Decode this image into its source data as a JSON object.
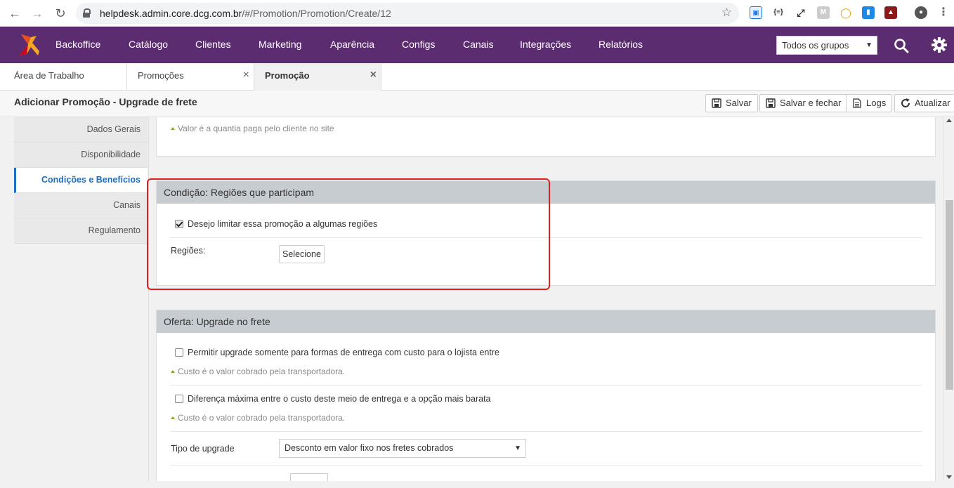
{
  "browser": {
    "url_host": "helpdesk.admin.core.dcg.com.br",
    "url_path": "/#/Promotion/Promotion/Create/12"
  },
  "header": {
    "menu": [
      "Backoffice",
      "Catálogo",
      "Clientes",
      "Marketing",
      "Aparência",
      "Configs",
      "Canais",
      "Integrações",
      "Relatórios"
    ],
    "group_select": "Todos os grupos",
    "brand_color": "#5b2c6f"
  },
  "tabs": [
    {
      "label": "Área de Trabalho"
    },
    {
      "label": "Promoções",
      "close": "×"
    },
    {
      "label": "Promoção",
      "close": "×"
    }
  ],
  "page": {
    "title": "Adicionar Promoção - Upgrade de frete",
    "buttons": {
      "save": "Salvar",
      "save_close": "Salvar e fechar",
      "logs": "Logs",
      "refresh": "Atualizar"
    }
  },
  "sidebar": {
    "items": [
      {
        "label": "Dados Gerais"
      },
      {
        "label": "Disponibilidade"
      },
      {
        "label": "Condições e Benefícios"
      },
      {
        "label": "Canais"
      },
      {
        "label": "Regulamento"
      }
    ]
  },
  "content": {
    "top_hint": "Valor é a quantia paga pelo cliente no site",
    "region_panel": {
      "title": "Condição: Regiões que participam",
      "checkbox_label": "Desejo limitar essa promoção a algumas regiões",
      "checked": true,
      "regions_label": "Regiões:",
      "select_button": "Selecione"
    },
    "offer_panel": {
      "title": "Oferta: Upgrade no frete",
      "checkbox1_label": "Permitir upgrade somente para formas de entrega com custo para o lojista entre",
      "hint1": "Custo é o valor cobrado pela transportadora.",
      "checkbox2_label": "Diferença máxima entre o custo deste meio de entrega e a opção mais barata",
      "hint2": "Custo é o valor cobrado pela transportadora.",
      "upgrade_type_label": "Tipo de upgrade",
      "upgrade_type_value": "Desconto em valor fixo nos fretes cobrados"
    }
  }
}
